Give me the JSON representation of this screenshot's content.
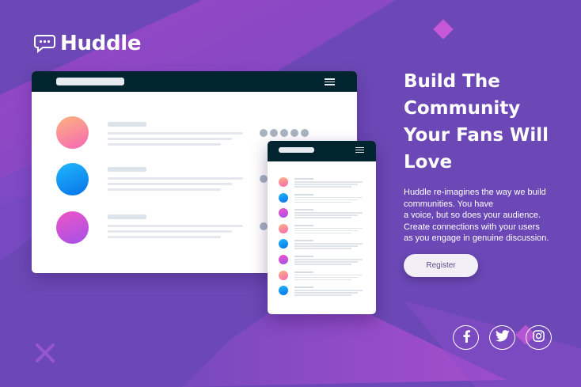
{
  "colors": {
    "background": "#6b48b5",
    "accent_pink": "#c658d8",
    "dark_header": "#00252e",
    "button_text": "#5c4a86"
  },
  "brand": {
    "name": "Huddle",
    "icon": "chat-bubble-icon"
  },
  "hero": {
    "headline_lines": [
      "Build The",
      "Community",
      "Your Fans Will",
      "Love"
    ],
    "description_lines": [
      "Huddle re-imagines the way we build",
      "communities. You have",
      "a voice, but so does your audience.",
      "Create connections with your users",
      "as you engage in genuine discussion."
    ],
    "register_label": "Register"
  },
  "social": [
    {
      "name": "facebook",
      "icon": "facebook-icon"
    },
    {
      "name": "twitter",
      "icon": "twitter-icon"
    },
    {
      "name": "instagram",
      "icon": "instagram-icon"
    }
  ]
}
